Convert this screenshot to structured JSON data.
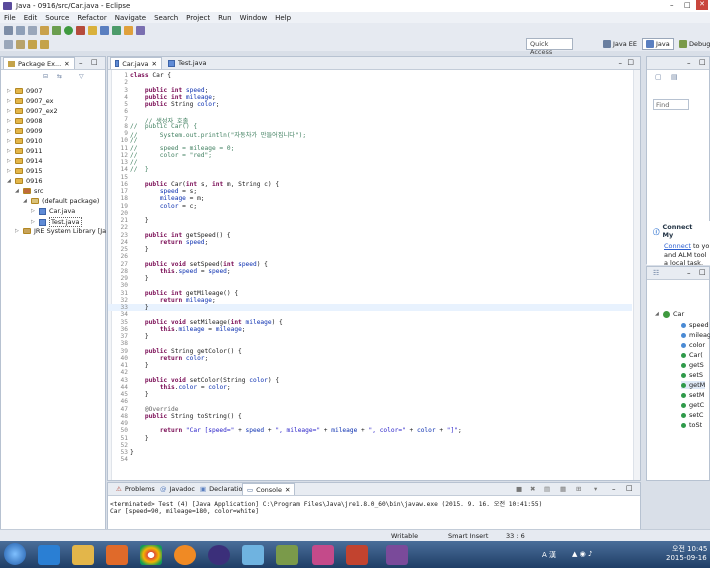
{
  "window": {
    "title": "Java - 0916/src/Car.java - Eclipse"
  },
  "menu": [
    "File",
    "Edit",
    "Source",
    "Refactor",
    "Navigate",
    "Search",
    "Project",
    "Run",
    "Window",
    "Help"
  ],
  "toolbar": {
    "quick_access": "Quick Access",
    "perspectives": [
      "Java EE",
      "Java",
      "Debug"
    ]
  },
  "package_explorer": {
    "tab": "Package Ex...",
    "items": [
      {
        "label": "0907",
        "level": 0
      },
      {
        "label": "0907_ex",
        "level": 0
      },
      {
        "label": "0907_ex2",
        "level": 0
      },
      {
        "label": "0908",
        "level": 0
      },
      {
        "label": "0909",
        "level": 0
      },
      {
        "label": "0910",
        "level": 0
      },
      {
        "label": "0911",
        "level": 0
      },
      {
        "label": "0914",
        "level": 0
      },
      {
        "label": "0915",
        "level": 0
      },
      {
        "label": "0916",
        "level": 0
      },
      {
        "label": "src",
        "level": 1
      },
      {
        "label": "(default package)",
        "level": 2
      },
      {
        "label": "Car.java",
        "level": 3
      },
      {
        "label": "Test.java",
        "level": 3
      },
      {
        "label": "JRE System Library [Ja",
        "level": 1
      }
    ]
  },
  "editor": {
    "tabs": [
      "Car.java",
      "Test.java"
    ],
    "lines": [
      {
        "n": "1",
        "t": "class Car {"
      },
      {
        "n": "2",
        "t": ""
      },
      {
        "n": "3",
        "t": "    public int speed;"
      },
      {
        "n": "4",
        "t": "    public int mileage;"
      },
      {
        "n": "5",
        "t": "    public String color;"
      },
      {
        "n": "6",
        "t": ""
      },
      {
        "n": "7",
        "t": "    // 생성자 호출"
      },
      {
        "n": "8",
        "t": "//  public Car() {"
      },
      {
        "n": "9",
        "t": "//      System.out.println(\"자동차가 만들어집니다\");"
      },
      {
        "n": "10",
        "t": "//"
      },
      {
        "n": "11",
        "t": "//      speed = mileage = 0;"
      },
      {
        "n": "12",
        "t": "//      color = \"red\";"
      },
      {
        "n": "13",
        "t": "//"
      },
      {
        "n": "14",
        "t": "//  }"
      },
      {
        "n": "15",
        "t": ""
      },
      {
        "n": "16",
        "t": "    public Car(int s, int m, String c) {"
      },
      {
        "n": "17",
        "t": "        speed = s;"
      },
      {
        "n": "18",
        "t": "        mileage = m;"
      },
      {
        "n": "19",
        "t": "        color = c;"
      },
      {
        "n": "20",
        "t": ""
      },
      {
        "n": "21",
        "t": "    }"
      },
      {
        "n": "22",
        "t": ""
      },
      {
        "n": "23",
        "t": "    public int getSpeed() {"
      },
      {
        "n": "24",
        "t": "        return speed;"
      },
      {
        "n": "25",
        "t": "    }"
      },
      {
        "n": "26",
        "t": ""
      },
      {
        "n": "27",
        "t": "    public void setSpeed(int speed) {"
      },
      {
        "n": "28",
        "t": "        this.speed = speed;"
      },
      {
        "n": "29",
        "t": "    }"
      },
      {
        "n": "30",
        "t": ""
      },
      {
        "n": "31",
        "t": "    public int getMileage() {"
      },
      {
        "n": "32",
        "t": "        return mileage;"
      },
      {
        "n": "33",
        "t": "    }"
      },
      {
        "n": "34",
        "t": ""
      },
      {
        "n": "35",
        "t": "    public void setMileage(int mileage) {"
      },
      {
        "n": "36",
        "t": "        this.mileage = mileage;"
      },
      {
        "n": "37",
        "t": "    }"
      },
      {
        "n": "38",
        "t": ""
      },
      {
        "n": "39",
        "t": "    public String getColor() {"
      },
      {
        "n": "40",
        "t": "        return color;"
      },
      {
        "n": "41",
        "t": "    }"
      },
      {
        "n": "42",
        "t": ""
      },
      {
        "n": "43",
        "t": "    public void setColor(String color) {"
      },
      {
        "n": "44",
        "t": "        this.color = color;"
      },
      {
        "n": "45",
        "t": "    }"
      },
      {
        "n": "46",
        "t": ""
      },
      {
        "n": "47",
        "t": "    @Override"
      },
      {
        "n": "48",
        "t": "    public String toString() {"
      },
      {
        "n": "49",
        "t": ""
      },
      {
        "n": "50",
        "t": "        return \"Car [speed=\" + speed + \", mileage=\" + mileage + \", color=\" + color + \"]\";"
      },
      {
        "n": "51",
        "t": "    }"
      },
      {
        "n": "52",
        "t": ""
      },
      {
        "n": "53",
        "t": "}"
      },
      {
        "n": "54",
        "t": ""
      }
    ]
  },
  "outline_top": {
    "find_placeholder": "Find",
    "connect_title": "Connect My",
    "connect_link": "Connect",
    "connect_text1": " to yo",
    "connect_text2": "and ALM tool",
    "connect_text3": "a local task."
  },
  "outline": {
    "root": "Car",
    "members": [
      "speed",
      "mileag",
      "color",
      "Car(",
      "getS",
      "setS",
      "getM",
      "setM",
      "getC",
      "setC",
      "toSt"
    ]
  },
  "console": {
    "tabs": [
      "Problems",
      "Javadoc",
      "Declaration",
      "Console"
    ],
    "header": "<terminated> Test (4) [Java Application] C:\\Program Files\\Java\\jre1.8.0_60\\bin\\javaw.exe (2015. 9. 16. 오전 10:41:55)",
    "output": "Car [speed=90, mileage=180, color=white]"
  },
  "status": {
    "writable": "Writable",
    "insert": "Smart Insert",
    "position": "33 : 6"
  },
  "taskbar": {
    "time": "오전 10:45",
    "date": "2015-09-16",
    "ime": "A 漢"
  }
}
